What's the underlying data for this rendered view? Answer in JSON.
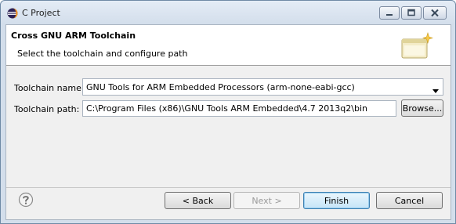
{
  "window": {
    "title": "C Project"
  },
  "banner": {
    "title": "Cross GNU ARM Toolchain",
    "description": "Select the toolchain and configure path"
  },
  "form": {
    "toolchain_name_label": "Toolchain name:",
    "toolchain_name_value": "GNU Tools for ARM Embedded Processors (arm-none-eabi-gcc)",
    "toolchain_path_label": "Toolchain path:",
    "toolchain_path_value": "C:\\Program Files (x86)\\GNU Tools ARM Embedded\\4.7 2013q2\\bin",
    "browse_label": "Browse..."
  },
  "footer": {
    "back_label": "< Back",
    "next_label": "Next >",
    "finish_label": "Finish",
    "cancel_label": "Cancel"
  },
  "icons": {
    "app": "eclipse-icon",
    "banner": "wizard-folder-icon",
    "help": "help-icon",
    "dropdown": "chevron-down-icon"
  },
  "colors": {
    "default_button_border": "#3c7fb1",
    "titlebar": "#dbe5f1"
  }
}
